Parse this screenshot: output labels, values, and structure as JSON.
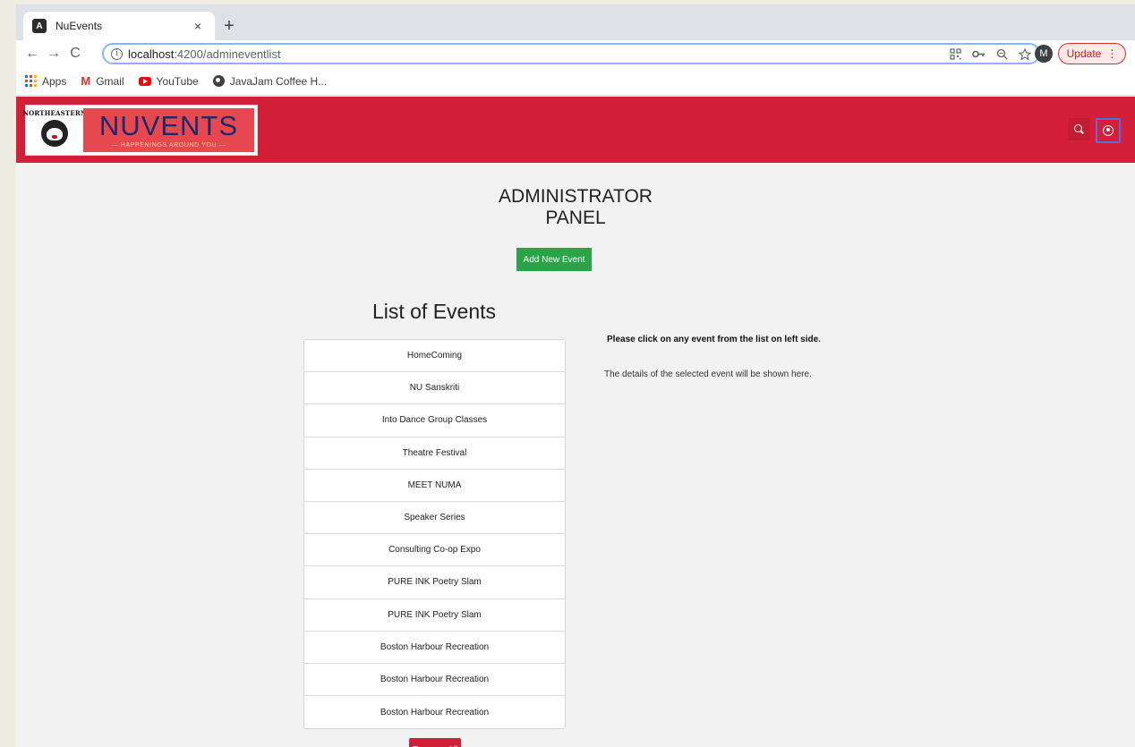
{
  "browser": {
    "tab_title": "NuEvents",
    "tab_favicon": "A",
    "tab_close": "×",
    "new_tab": "+",
    "nav": {
      "back": "←",
      "forward": "→",
      "reload": "C"
    },
    "url_host": "localhost",
    "url_path": ":4200/admineventlist",
    "omnibox_icons": [
      "qr-icon",
      "key-icon",
      "zoom-icon",
      "star-icon"
    ],
    "profile_initial": "M",
    "update_label": "Update",
    "update_menu": "⋮",
    "bookmarks": [
      {
        "label": "Apps",
        "icon": "apps-icon"
      },
      {
        "label": "Gmail",
        "icon": "gmail-icon"
      },
      {
        "label": "YouTube",
        "icon": "youtube-icon"
      },
      {
        "label": "JavaJam Coffee H...",
        "icon": "globe-icon"
      }
    ]
  },
  "app": {
    "logo": {
      "university": "NORTHEASTERN",
      "title": "NUVENTS",
      "tagline": "— HAPPENINGS AROUND YOU —"
    },
    "panel_title_line1": "ADMINISTRATOR",
    "panel_title_line2": "PANEL",
    "add_button": "Add New Event",
    "list_title": "List of Events",
    "events": [
      "HomeComing",
      "NU Sanskriti",
      "Into Dance Group Classes",
      "Theatre Festival",
      "MEET NUMA",
      "Speaker Series",
      "Consulting Co-op Expo",
      "PURE INK Poetry Slam",
      "PURE INK Poetry Slam",
      "Boston Harbour Recreation",
      "Boston Harbour Recreation",
      "Boston Harbour Recreation"
    ],
    "detail_heading": "Please click on any event from the list on left side.",
    "detail_note": "The details of the selected event will be shown here.",
    "remove_button": "Remove All"
  },
  "colors": {
    "header_red": "#d31f37",
    "add_green": "#29a547",
    "logo_navy": "#1b2a6b"
  }
}
